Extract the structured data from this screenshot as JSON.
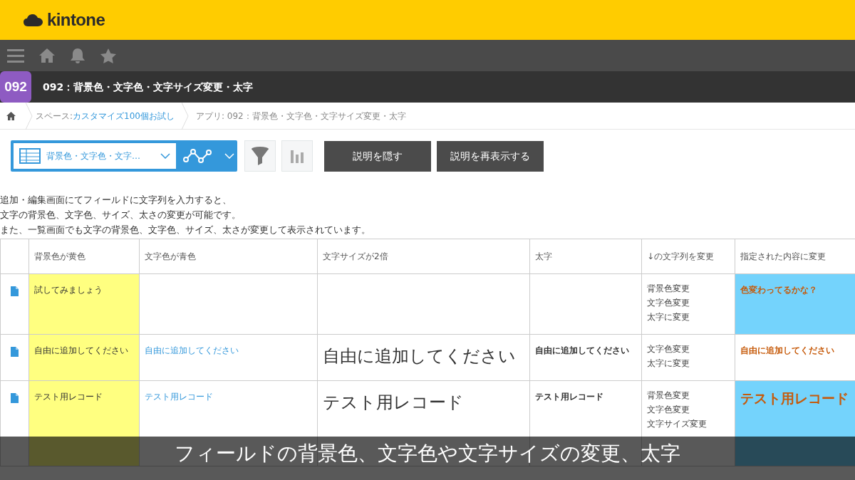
{
  "header": {
    "logo": "kintone"
  },
  "app": {
    "badge": "092",
    "title": "092：背景色・文字色・文字サイズ変更・太字"
  },
  "breadcrumb": {
    "space_label": "スペース: ",
    "space_link": "カスタマイズ100個お試し",
    "app": "アプリ: 092：背景色・文字色・文字サイズ変更・太字"
  },
  "toolbar": {
    "view": "背景色・文字色・文字…",
    "buttons": [
      "説明を隠す",
      "説明を再表示する"
    ]
  },
  "description": [
    "追加・編集画面にてフィールドに文字列を入力すると、",
    "文字の背景色、文字色、サイズ、太さの変更が可能です。",
    "また、一覧画面でも文字の背景色、文字色、サイズ、太さが変更して表示されています。"
  ],
  "table": {
    "columns": [
      {
        "label": "背景色が黄色",
        "kind": "yellow"
      },
      {
        "label": "文字色が青色",
        "kind": "blue"
      },
      {
        "label": "文字サイズが2倍",
        "kind": "double"
      },
      {
        "label": "太字",
        "kind": "bold"
      },
      {
        "label": "↓の文字列を変更",
        "kind": "lines"
      },
      {
        "label": "指定された内容に変更",
        "kind": "result"
      }
    ],
    "rows": [
      {
        "cells": [
          "試してみましょう",
          null,
          null,
          null,
          [
            "背景色変更",
            "文字色変更",
            "太字に変更"
          ],
          {
            "text": "色変わってるかな？",
            "kind": "highlight"
          }
        ]
      },
      {
        "cells": [
          "自由に追加してください",
          "自由に追加してください",
          "自由に追加してください",
          "自由に追加してください",
          [
            "文字色変更",
            "太字に変更"
          ],
          {
            "text": "自由に追加してください",
            "kind": "plain"
          }
        ]
      },
      {
        "cells": [
          "テスト用レコード",
          "テスト用レコード",
          "テスト用レコード",
          "テスト用レコード",
          [
            "背景色変更",
            "文字色変更",
            "文字サイズ変更"
          ],
          {
            "text": "テスト用レコード",
            "kind": "highlight-large"
          }
        ]
      }
    ]
  },
  "caption": "フィールドの背景色、文字色や文字サイズの変更、太字"
}
